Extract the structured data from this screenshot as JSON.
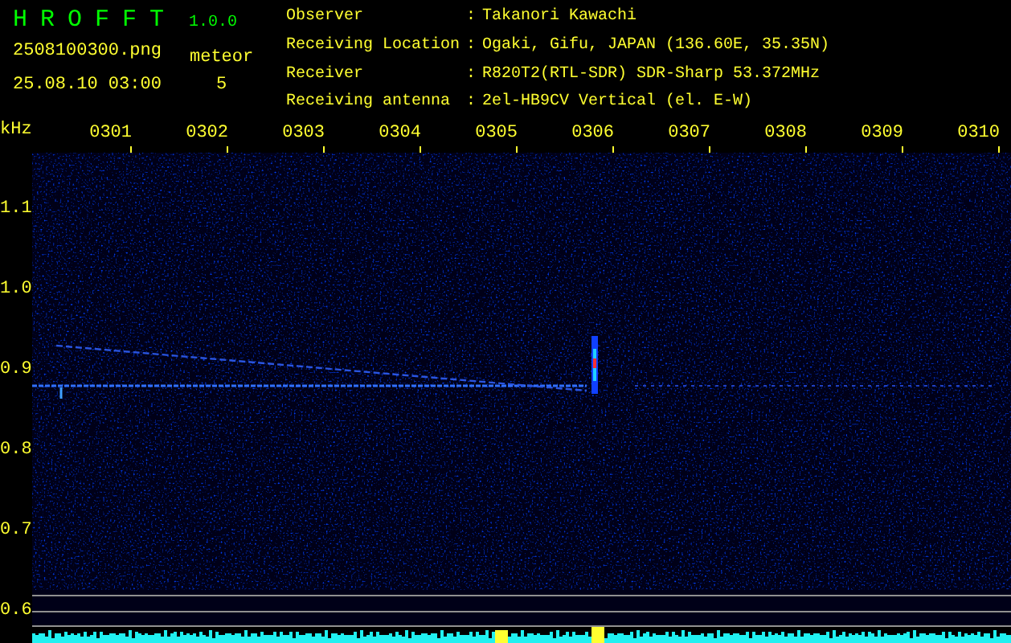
{
  "header": {
    "app_name": "H R O F F T",
    "version": "1.0.0",
    "filename": "2508100300.png",
    "datetime": "25.08.10 03:00",
    "meteor_label": "meteor",
    "meteor_count": "5",
    "info": [
      {
        "label": "Observer",
        "separator": ":",
        "value": "Takanori Kawachi"
      },
      {
        "label": "Receiving Location",
        "separator": ":",
        "value": "Ogaki, Gifu, JAPAN (136.60E, 35.35N)"
      },
      {
        "label": "Receiver",
        "separator": ":",
        "value": "R820T2(RTL-SDR) SDR-Sharp 53.372MHz"
      },
      {
        "label": "Receiving antenna",
        "separator": ":",
        "value": "2el-HB9CV Vertical (el. E-W)"
      }
    ]
  },
  "axis": {
    "unit": "kHz",
    "time_labels": [
      "0301",
      "0302",
      "0303",
      "0304",
      "0305",
      "0306",
      "0307",
      "0308",
      "0309",
      "0310"
    ],
    "freq_labels": [
      "1.1",
      "1.0",
      "0.9",
      "0.8",
      "0.7",
      "0.6"
    ]
  }
}
